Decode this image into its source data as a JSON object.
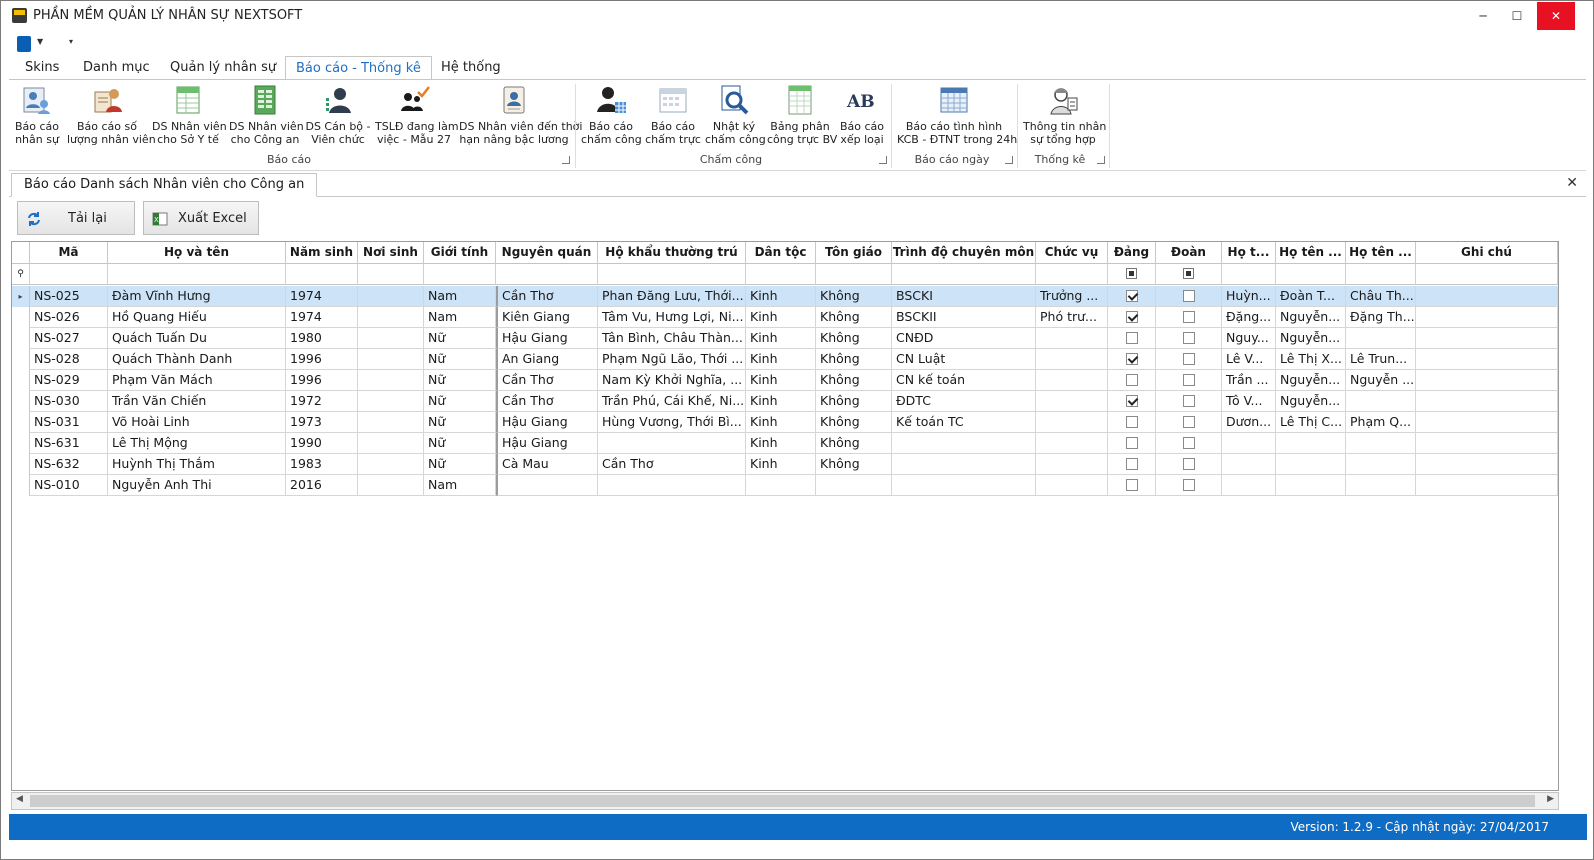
{
  "window": {
    "title": "PHẦN MỀM QUẢN LÝ NHÂN SỰ NEXTSOFT",
    "controls": {
      "minimize": "─",
      "maximize": "☐",
      "close": "✕"
    }
  },
  "ribbon_tabs": [
    {
      "label": "Skins"
    },
    {
      "label": "Danh mục"
    },
    {
      "label": "Quản lý nhân sự"
    },
    {
      "label": "Báo cáo - Thống kê",
      "active": true
    },
    {
      "label": "Hệ thống"
    }
  ],
  "ribbon": {
    "groups": [
      {
        "label": "Báo cáo",
        "buttons": [
          {
            "l1": "Báo cáo",
            "l2": "nhân sự",
            "icon": "people-report-icon"
          },
          {
            "l1": "Báo cáo số",
            "l2": "lượng nhân viên",
            "icon": "staff-count-icon"
          },
          {
            "l1": "DS Nhân viên",
            "l2": "cho Sở Y tế",
            "icon": "spreadsheet-green-icon"
          },
          {
            "l1": "DS Nhân viên",
            "l2": "cho Công an",
            "icon": "spreadsheet-icon"
          },
          {
            "l1": "DS Cán bộ -",
            "l2": "Viên chức",
            "icon": "officer-icon"
          },
          {
            "l1": "TSLĐ đang làm",
            "l2": "việc - Mẫu 27",
            "icon": "checked-people-icon"
          },
          {
            "l1": "DS Nhân viên đến thời",
            "l2": "hạn nâng bậc lương",
            "icon": "id-card-icon"
          }
        ]
      },
      {
        "label": "Chấm công",
        "buttons": [
          {
            "l1": "Báo cáo",
            "l2": "chấm công",
            "icon": "timesheet-person-icon"
          },
          {
            "l1": "Báo cáo",
            "l2": "chấm trực",
            "icon": "calendar-icon"
          },
          {
            "l1": "Nhật ký",
            "l2": "chấm công",
            "icon": "magnifier-doc-icon"
          },
          {
            "l1": "Bảng phân",
            "l2": "công trực BV",
            "icon": "roster-icon"
          },
          {
            "l1": "Báo cáo",
            "l2": "xếp loại",
            "icon": "ab-icon"
          }
        ]
      },
      {
        "label": "Báo cáo ngày",
        "buttons": [
          {
            "l1": "Báo cáo tình hình",
            "l2": "KCB - ĐTNT trong 24h",
            "icon": "grid-table-icon"
          }
        ]
      },
      {
        "label": "Thống kê",
        "buttons": [
          {
            "l1": "Thông tin nhân",
            "l2": "sự tổng hợp",
            "icon": "worker-info-icon"
          }
        ]
      }
    ]
  },
  "document_tab": {
    "label": "Báo cáo Danh sách Nhân viên cho Công an",
    "close": "✕"
  },
  "toolbar": {
    "reload_label": "Tải lại",
    "export_label": "Xuất Excel"
  },
  "grid": {
    "columns": [
      "Mã",
      "Họ và tên",
      "Năm sinh",
      "Nơi sinh",
      "Giới tính",
      "Nguyên quán",
      "Hộ khẩu thường trú",
      "Dân tộc",
      "Tôn giáo",
      "Trình độ chuyên môn",
      "Chức vụ",
      "Đảng",
      "Đoàn",
      "Họ t...",
      "Họ tên ...",
      "Họ tên ...",
      "Ghi chú"
    ],
    "rows": [
      {
        "ma": "NS-025",
        "ten": "Đàm Vĩnh Hưng",
        "nam": "1974",
        "noisinh": "",
        "gt": "Nam",
        "nq": "Cần Thơ",
        "hk": "Phan Đăng Lưu, Thới...",
        "dt": "Kinh",
        "tg": "Không",
        "td": "BSCKI",
        "cv": "Trưởng ...",
        "dang": true,
        "doan": false,
        "h1": "Huỳn...",
        "h2": "Đoàn T...",
        "h3": "Châu Th...",
        "gc": "",
        "selected": true
      },
      {
        "ma": "NS-026",
        "ten": "Hồ Quang Hiếu",
        "nam": "1974",
        "noisinh": "",
        "gt": "Nam",
        "nq": "Kiên Giang",
        "hk": "Tâm Vu, Hưng Lợi, Ni...",
        "dt": "Kinh",
        "tg": "Không",
        "td": "BSCKII",
        "cv": "Phó trư...",
        "dang": true,
        "doan": false,
        "h1": "Đặng...",
        "h2": "Nguyễn...",
        "h3": "Đặng Th...",
        "gc": ""
      },
      {
        "ma": "NS-027",
        "ten": "Quách Tuấn Du",
        "nam": "1980",
        "noisinh": "",
        "gt": "Nữ",
        "nq": "Hậu Giang",
        "hk": "Tân Bình, Châu Thàn...",
        "dt": "Kinh",
        "tg": "Không",
        "td": "CNĐD",
        "cv": "",
        "dang": false,
        "doan": false,
        "h1": "Nguy...",
        "h2": "Nguyễn...",
        "h3": "",
        "gc": ""
      },
      {
        "ma": "NS-028",
        "ten": "Quách Thành Danh",
        "nam": "1996",
        "noisinh": "",
        "gt": "Nữ",
        "nq": "An Giang",
        "hk": "Phạm Ngũ Lão, Thới ...",
        "dt": "Kinh",
        "tg": "Không",
        "td": "CN Luật",
        "cv": "",
        "dang": true,
        "doan": false,
        "h1": "Lê V...",
        "h2": "Lê Thị X...",
        "h3": "Lê Trun...",
        "gc": ""
      },
      {
        "ma": "NS-029",
        "ten": "Phạm Văn Mách",
        "nam": "1996",
        "noisinh": "",
        "gt": "Nữ",
        "nq": "Cần Thơ",
        "hk": "Nam Kỳ Khởi Nghĩa, ...",
        "dt": "Kinh",
        "tg": "Không",
        "td": "CN kế toán",
        "cv": "",
        "dang": false,
        "doan": false,
        "h1": "Trần ...",
        "h2": "Nguyễn...",
        "h3": "Nguyễn ...",
        "gc": ""
      },
      {
        "ma": "NS-030",
        "ten": "Trần Văn Chiến",
        "nam": "1972",
        "noisinh": "",
        "gt": "Nữ",
        "nq": "Cần Thơ",
        "hk": "Trần Phú, Cái Khế, Ni...",
        "dt": "Kinh",
        "tg": "Không",
        "td": "ĐDTC",
        "cv": "",
        "dang": true,
        "doan": false,
        "h1": "Tô V...",
        "h2": "Nguyễn...",
        "h3": "",
        "gc": ""
      },
      {
        "ma": "NS-031",
        "ten": "Võ Hoài Linh",
        "nam": "1973",
        "noisinh": "",
        "gt": "Nữ",
        "nq": "Hậu Giang",
        "hk": "Hùng Vương, Thới Bì...",
        "dt": "Kinh",
        "tg": "Không",
        "td": "Kế toán TC",
        "cv": "",
        "dang": false,
        "doan": false,
        "h1": "Dươn...",
        "h2": "Lê Thị C...",
        "h3": "Phạm Q...",
        "gc": ""
      },
      {
        "ma": "NS-631",
        "ten": "Lê Thị Mộng",
        "nam": "1990",
        "noisinh": "",
        "gt": "Nữ",
        "nq": "Hậu Giang",
        "hk": "",
        "dt": "Kinh",
        "tg": "Không",
        "td": "",
        "cv": "",
        "dang": false,
        "doan": false,
        "h1": "",
        "h2": "",
        "h3": "",
        "gc": ""
      },
      {
        "ma": "NS-632",
        "ten": "Huỳnh Thị Thắm",
        "nam": "1983",
        "noisinh": "",
        "gt": "Nữ",
        "nq": "Cà Mau",
        "hk": "Cần Thơ",
        "dt": "Kinh",
        "tg": "Không",
        "td": "",
        "cv": "",
        "dang": false,
        "doan": false,
        "h1": "",
        "h2": "",
        "h3": "",
        "gc": ""
      },
      {
        "ma": "NS-010",
        "ten": "Nguyễn Anh Thi",
        "nam": "2016",
        "noisinh": "",
        "gt": "Nam",
        "nq": "",
        "hk": "",
        "dt": "",
        "tg": "",
        "td": "",
        "cv": "",
        "dang": false,
        "doan": false,
        "h1": "",
        "h2": "",
        "h3": "",
        "gc": ""
      }
    ]
  },
  "status": {
    "text": "Version: 1.2.9 - Cập nhật ngày: 27/04/2017"
  },
  "colors": {
    "accent": "#1f6fc5",
    "statusbar": "#0f6cc4",
    "selected_row": "#cde3f7"
  }
}
